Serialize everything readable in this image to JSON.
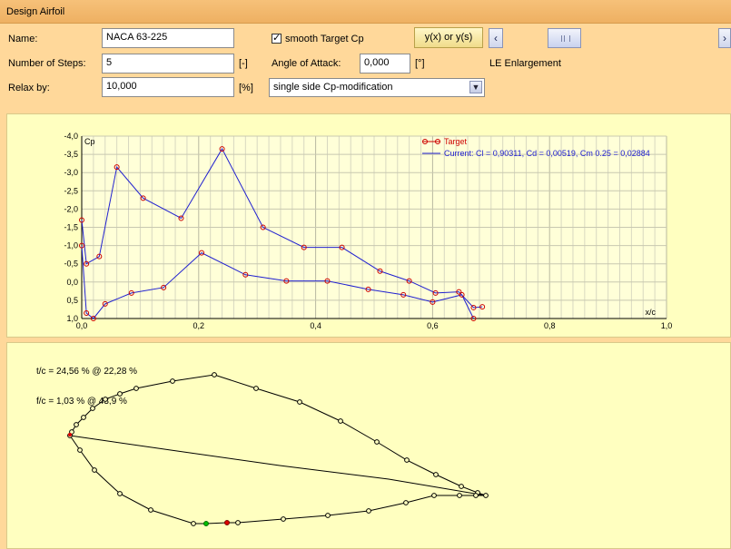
{
  "header": {
    "title": "Design Airfoil"
  },
  "form": {
    "name_label": "Name:",
    "name_value": "NACA 63-225",
    "smooth_label": "smooth Target Cp",
    "smooth_checked": true,
    "yx_button_label": "y(x) or y(s)",
    "steps_label": "Number of Steps:",
    "steps_value": "5",
    "steps_unit": "[-]",
    "aoa_label": "Angle of Attack:",
    "aoa_value": "0,000",
    "aoa_unit": "[°]",
    "le_label": "LE Enlargement",
    "relax_label": "Relax by:",
    "relax_value": "10,000",
    "relax_unit": "[%]",
    "mode_value": "single side Cp-modification",
    "slider_left_icon": "chevron-left-icon",
    "slider_right_icon": "chevron-right-icon"
  },
  "chart_data": {
    "type": "line",
    "xlabel": "x/c",
    "ylabel": "Cp",
    "xlim": [
      0.0,
      1.0
    ],
    "ylim": [
      1.0,
      -4.0
    ],
    "y_inverted": true,
    "grid": true,
    "legend_position": "top-right",
    "x_ticks": [
      "0,0",
      "0,2",
      "0,4",
      "0,6",
      "0,8",
      "1,0"
    ],
    "y_ticks": [
      "-4,0",
      "-3,5",
      "-3,0",
      "-2,5",
      "-2,0",
      "-1,5",
      "-1,0",
      "-0,5",
      "0,0",
      "0,5",
      "1,0"
    ],
    "series": [
      {
        "name": "Target",
        "color": "#cc0000",
        "marker": "circle",
        "upper_x": [
          0.0,
          0.008,
          0.03,
          0.06,
          0.105,
          0.17,
          0.24,
          0.31,
          0.38,
          0.445,
          0.51,
          0.56,
          0.605,
          0.645,
          0.67,
          0.685
        ],
        "upper_y": [
          -1.7,
          -0.5,
          -0.7,
          -3.15,
          -2.3,
          -1.75,
          -3.65,
          -1.5,
          -0.95,
          -0.95,
          -0.3,
          -0.03,
          0.3,
          0.27,
          0.7,
          0.68
        ],
        "lower_x": [
          0.0,
          0.008,
          0.02,
          0.04,
          0.085,
          0.14,
          0.205,
          0.28,
          0.35,
          0.42,
          0.49,
          0.55,
          0.6,
          0.65,
          0.67
        ],
        "lower_y": [
          -1.0,
          0.85,
          1.0,
          0.6,
          0.3,
          0.15,
          -0.8,
          -0.2,
          -0.03,
          -0.03,
          0.2,
          0.35,
          0.55,
          0.35,
          1.0
        ]
      },
      {
        "name": "Current: Cl = 0,90311, Cd = 0,00519, Cm 0.25 = 0,02884",
        "color": "#2020d0"
      }
    ]
  },
  "airfoil_panel": {
    "tc_text": "t/c = 24,56 % @ 22,28 %",
    "fc_text": "f/c = 1,03 % @ 43,9 %"
  }
}
